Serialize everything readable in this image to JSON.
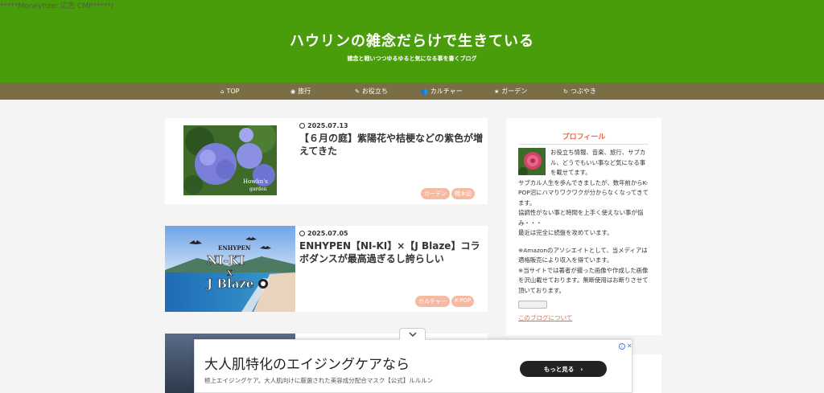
{
  "moneytizer_comment": "*****Moneytizer 広告 CMP*****/",
  "header": {
    "title": "ハウリンの雑念だらけで生きている",
    "tagline": "雑念と戦いつつゆるゆると気になる事を書くブログ",
    "bg_color": "#4a9d0a"
  },
  "nav": {
    "bg_color": "#7b6d45",
    "items": [
      {
        "label": "TOP",
        "icon": "home-icon",
        "glyph": "⌂"
      },
      {
        "label": "旅行",
        "icon": "globe-icon",
        "glyph": "◉"
      },
      {
        "label": "お役立ち",
        "icon": "pencil-icon",
        "glyph": "✎"
      },
      {
        "label": "カルチャー",
        "icon": "users-icon",
        "glyph": "👥"
      },
      {
        "label": "ガーデン",
        "icon": "star-icon",
        "glyph": "★"
      },
      {
        "label": "つぶやき",
        "icon": "refresh-icon",
        "glyph": "↻"
      }
    ]
  },
  "posts": [
    {
      "date": "2025.07.13",
      "title": "【６月の庭】紫陽花や桔梗などの紫色が増えてきた",
      "tags": [
        "ガーデン",
        "雑木庭"
      ],
      "thumb_caption": "Howlin's garden"
    },
    {
      "date": "2025.07.05",
      "title": "ENHYPEN【NI-KI】×【J Blaze】コラボダンスが最高過ぎるし誇らしい",
      "tags": [
        "カルチャー",
        "K-POP"
      ],
      "thumb": {
        "brand": "ENHYPEN",
        "line1": "NI-KI",
        "line2": "X",
        "line3": "J Blaze"
      }
    },
    {
      "date": "",
      "title": "",
      "tags": []
    }
  ],
  "sidebar": {
    "heading": "プロフィール",
    "profile_text": "お役立ち情報、音楽、旅行、サブカル、どうでもいい事など気になる事を載せてます。",
    "profile_lines": [
      "サブカル人生を歩んできましたが、数年前からK-POP沼にハマりワクワクが分からなくなってきてます。",
      "協調性がない事と時間を上手く使えない事が悩み・・・",
      "最近は完全に続盤を攻めています。"
    ],
    "disclaimer": [
      "※Amazonのアソシエイトとして、当メディアは適格販売により収入を得ています。",
      "※当サイトでは著者が撮った画像や作成した画像を沢山載せております。無断使用はお断りさせて頂いております。"
    ],
    "about_link": "このブログについて"
  },
  "ad": {
    "headline": "大人肌特化のエイジングケアなら",
    "sub": "極上エイジングケア。大人肌向けに厳選された美容成分配合マスク【公式】ルルルン",
    "button": "もっと見る",
    "info_glyph": "i",
    "close_glyph": "✕"
  }
}
